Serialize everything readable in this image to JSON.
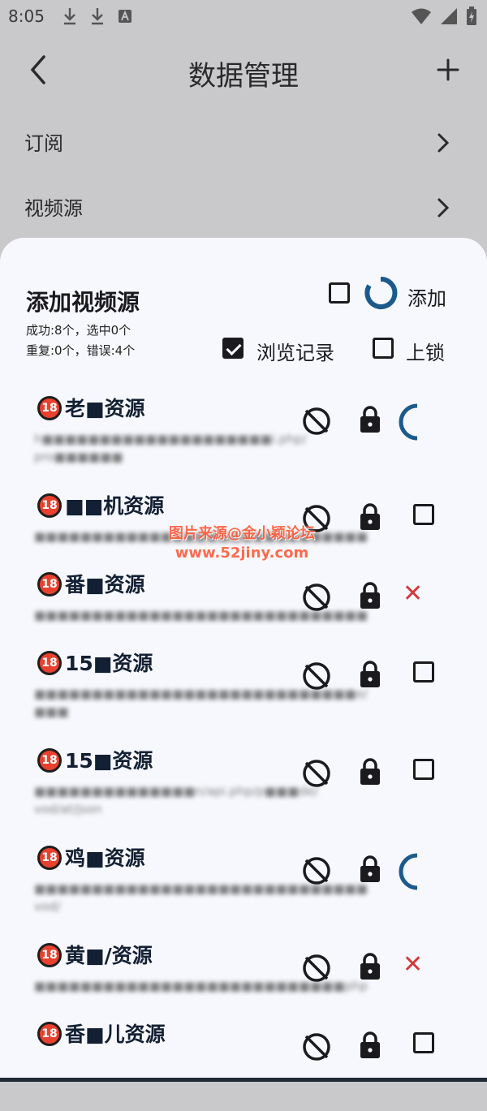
{
  "status_bar": {
    "time": "8:05"
  },
  "app_bar": {
    "title": "数据管理"
  },
  "menu": [
    {
      "label": "订阅"
    },
    {
      "label": "视频源"
    }
  ],
  "sheet": {
    "title": "添加视频源",
    "stats_line1": "成功:8个，选中0个",
    "stats_line2": "重复:0个，错误:4个",
    "add_label": "添加",
    "browse_history_label": "浏览记录",
    "browse_history_checked": true,
    "lock_label": "上锁",
    "lock_checked": false
  },
  "rows": [
    {
      "badge": "18",
      "name": "老■资源",
      "url": "h■■■■■■■■■■■■■■■■■■■■i.php/ pro■■■■■■",
      "status": "loading"
    },
    {
      "badge": "18",
      "name": "■■机资源",
      "url": "■■■■■■■■■■■■■■■■■■■■■■■■■■■■■",
      "status": "unchecked"
    },
    {
      "badge": "18",
      "name": "番■资源",
      "url": "■■■■■■■■■■■■■■■■■■■■■■■■■■■■■",
      "status": "error"
    },
    {
      "badge": "18",
      "name": "15■资源",
      "url": "■■■■■■■■■■■■■■■■■■■■■■■■■■■■e/ ■■■",
      "status": "unchecked"
    },
    {
      "badge": "18",
      "name": "15■资源",
      "url": "■■■■■■■■■■■■■■n/api.php/p■■■de/ vod/at/json",
      "status": "unchecked"
    },
    {
      "badge": "18",
      "name": "鸡■资源",
      "url": "■■■■■■■■■■■■■■■■■■■■■■■■■■■■■ vod/",
      "status": "loading"
    },
    {
      "badge": "18",
      "name": "黄■/资源",
      "url": "■■■■■■■■■■■■■■■■■■■■■■■■■■■php",
      "status": "error"
    },
    {
      "badge": "18",
      "name": "香■儿资源",
      "url": "",
      "status": "unchecked"
    }
  ],
  "watermark": {
    "line1": "图片来源@金小颖论坛",
    "line2": "www.52jiny.com"
  },
  "colors": {
    "accent": "#1c5a8c",
    "error": "#d33a3a",
    "sheet_bg": "#f7f8fd",
    "scrim_bg": "#c9c9cc"
  }
}
